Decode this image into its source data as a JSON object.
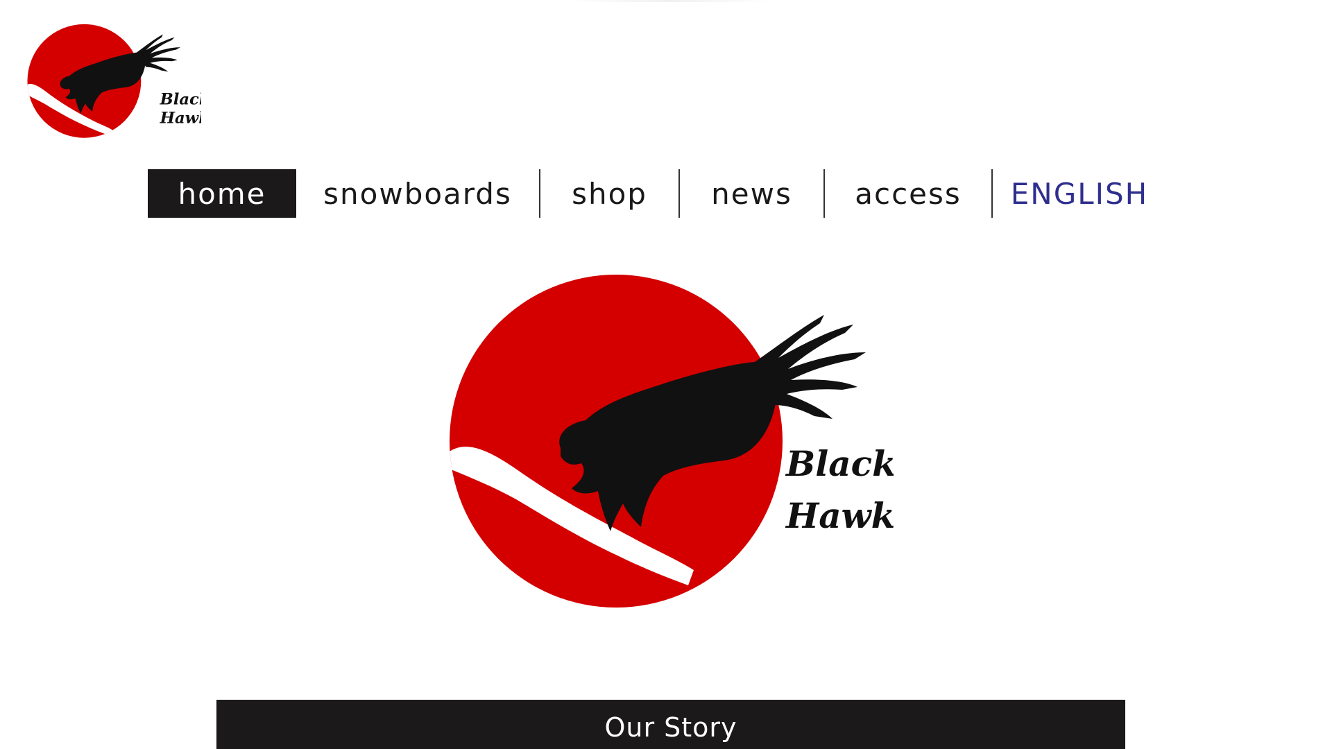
{
  "brand": {
    "name_line1": "Black",
    "name_line2": "Hawk",
    "colors": {
      "sun_red": "#d40000",
      "ink": "#111111",
      "nav_active_bg": "#1b1919",
      "lang_link": "#2f2f8f"
    }
  },
  "nav": {
    "items": [
      {
        "label": "home",
        "active": true
      },
      {
        "label": "snowboards",
        "active": false
      },
      {
        "label": "shop",
        "active": false
      },
      {
        "label": "news",
        "active": false
      },
      {
        "label": "access",
        "active": false
      }
    ],
    "language_link": "ENGLISH"
  },
  "sections": {
    "story_title": "Our Story"
  },
  "icons": {
    "logo": "black-hawk-logo-icon",
    "hero": "black-hawk-hero-logo-icon"
  }
}
